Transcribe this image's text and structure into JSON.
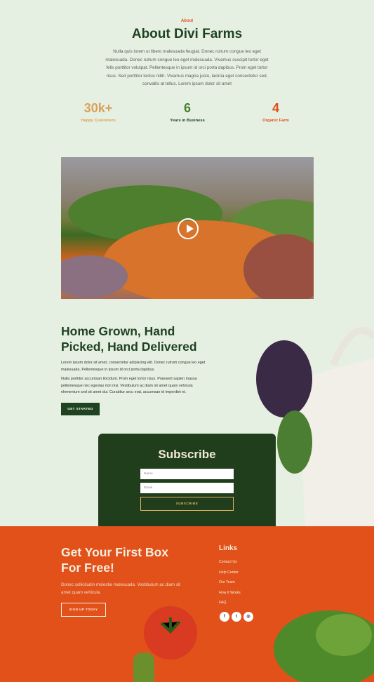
{
  "about": {
    "eyebrow": "About",
    "title": "About Divi Farms",
    "intro": "Nulla quis lorem ut libero malesuada feugiat. Donec rutrum congue leo eget malesuada. Donec rutrum congue leo eget malesuada. Vivamus suscipit tortor eget felis porttitor volutpat. Pellentesque in ipsum id orci porta dapibus. Proin eget tortor risus. Sed porttitor lectus nibh. Vivamus magna justo, lacinia eget consectetur sed, convallis at tellus. Lorem ipsum dolor sit amet",
    "stats": [
      {
        "value": "30k+",
        "label": "Happy Customers",
        "color": "#d9a15c"
      },
      {
        "value": "6",
        "label": "Years in Business",
        "color": "#4b7d33"
      },
      {
        "value": "4",
        "label": "Organic Farm",
        "color": "#e04f17"
      }
    ]
  },
  "home": {
    "title": "Home Grown, Hand Picked, Hand Delivered",
    "p1": "Lorem ipsum dolor sit amet, consectetur adipiscing elit. Donec rutrum congue leo eget malesuada. Pellentesque in ipsum id orci porta dapibus.",
    "p2": "Nulla porttitor accumsan tincidunt. Proin eget tortor risus. Praesent sapien massa pellentesque nec egestas non nisi. Vestibulum ac diam sit amet quam vehicula elementum sed sit amet dui. Curabitur arcu erat, accumsan id imperdiet et.",
    "button": "GET STARTED"
  },
  "subscribe": {
    "title": "Subscribe",
    "name_placeholder": "Name",
    "email_placeholder": "Email",
    "button": "SUBSCRIBE"
  },
  "footer": {
    "title": "Get Your First Box For Free!",
    "text": "Donec sollicitudin molestie malesuada. Vestibulum ac diam sit amet quam vehicula.",
    "button": "SIGN UP TODAY",
    "links_title": "Links",
    "links": [
      "Contact Us",
      "Help Center",
      "Our Team",
      "How It Works",
      "FAQ"
    ],
    "social": [
      "f",
      "t",
      "◎"
    ]
  }
}
